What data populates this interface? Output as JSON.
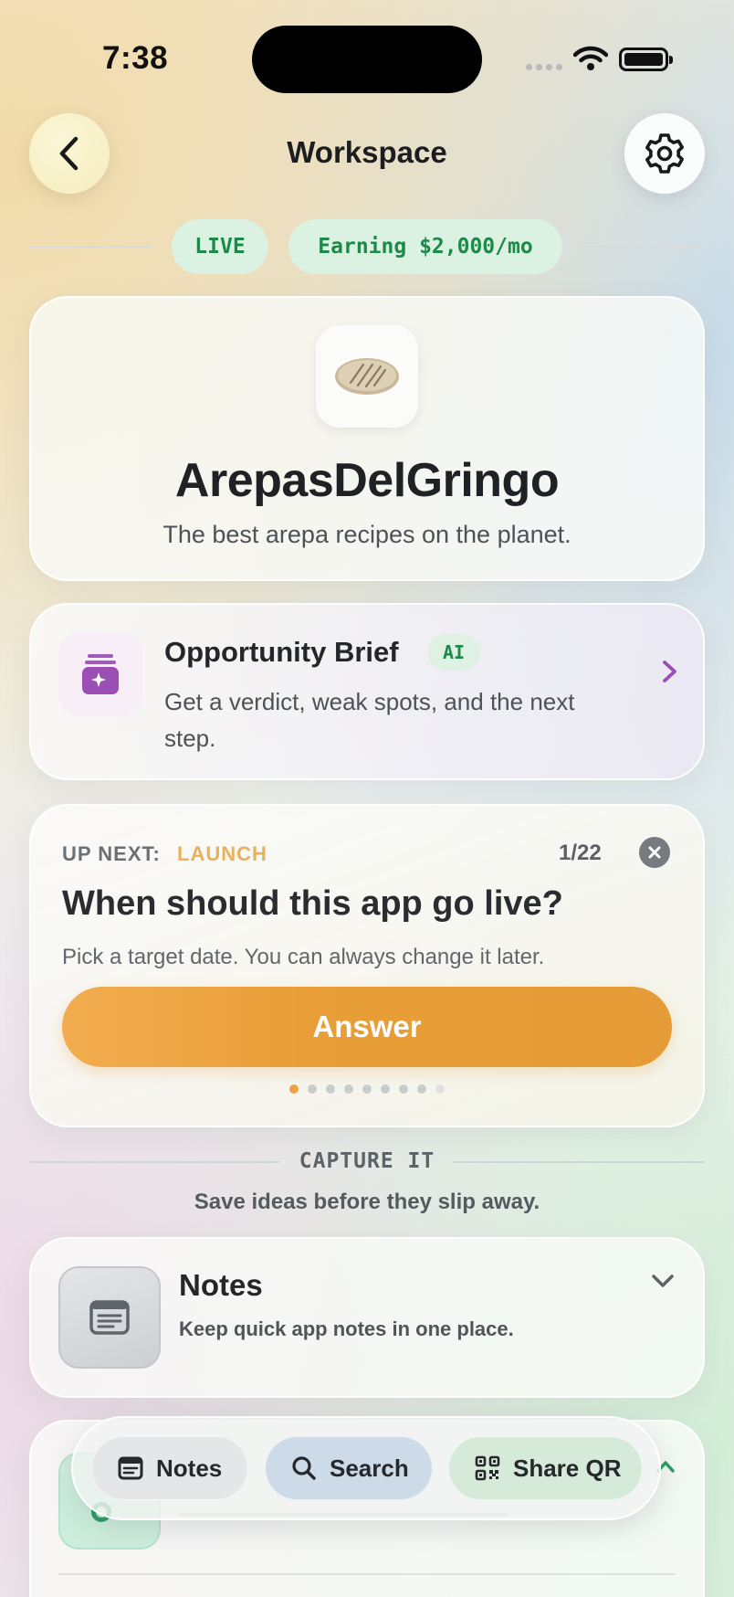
{
  "status_bar": {
    "time": "7:38"
  },
  "header": {
    "title": "Workspace"
  },
  "status_pills": {
    "live": "LIVE",
    "earning": "Earning $2,000/mo"
  },
  "app": {
    "name": "ArepasDelGringo",
    "tagline": "The best arepa recipes on the planet."
  },
  "brief": {
    "title": "Opportunity Brief",
    "badge": "AI",
    "description": "Get a verdict, weak spots, and the next step."
  },
  "up_next": {
    "label": "UP NEXT:",
    "phase": "LAUNCH",
    "counter": "1/22",
    "question": "When should this app go live?",
    "hint": "Pick a target date. You can always change it later.",
    "button": "Answer",
    "pager_total": 9,
    "pager_active": 0
  },
  "capture": {
    "title": "CAPTURE IT",
    "subtitle": "Save ideas before they slip away."
  },
  "notes_card": {
    "title": "Notes",
    "subtitle": "Keep quick app notes in one place."
  },
  "dock": {
    "notes": "Notes",
    "search": "Search",
    "share_qr": "Share QR"
  },
  "colors": {
    "accent_orange": "#E99E37",
    "live_green": "#1E8A4A",
    "brief_purple": "#9B4FB5"
  },
  "icons": [
    "chevron-left-icon",
    "gear-icon",
    "arepa-icon",
    "sparkle-box-icon",
    "chevron-right-icon",
    "close-icon",
    "notes-doc-icon",
    "chevron-down-icon",
    "search-icon",
    "qr-icon"
  ]
}
